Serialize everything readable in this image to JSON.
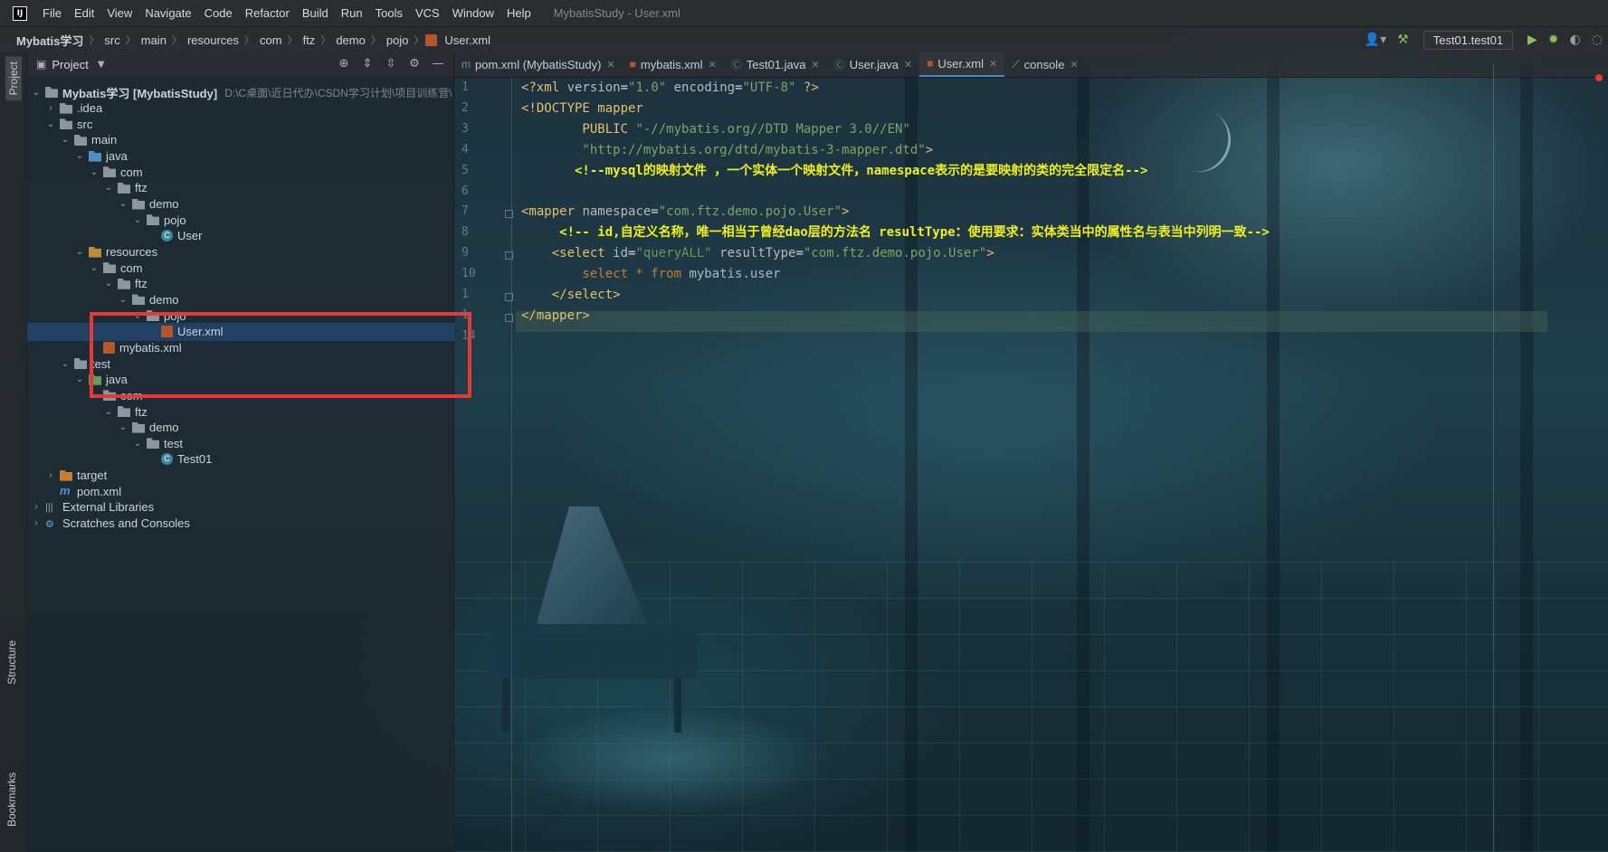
{
  "menubar": {
    "logo": "IJ",
    "items": [
      "File",
      "Edit",
      "View",
      "Navigate",
      "Code",
      "Refactor",
      "Build",
      "Run",
      "Tools",
      "VCS",
      "Window",
      "Help"
    ],
    "window_title": "MybatisStudy - User.xml"
  },
  "breadcrumb": [
    "Mybatis学习",
    "src",
    "main",
    "resources",
    "com",
    "ftz",
    "demo",
    "pojo",
    "User.xml"
  ],
  "toolbar": {
    "run_config": "Test01.test01"
  },
  "tool_strip": {
    "project": "Project",
    "structure": "Structure",
    "bookmarks": "Bookmarks"
  },
  "project_panel": {
    "title": "Project"
  },
  "tree": [
    {
      "label": "Mybatis学习 [MybatisStudy]",
      "hint": "D:\\C桌面\\近日代办\\CSDN学习计划\\项目训练营\\",
      "depth": 0,
      "chev": "v",
      "icon": "folder"
    },
    {
      "label": ".idea",
      "depth": 1,
      "chev": ">",
      "icon": "folder"
    },
    {
      "label": "src",
      "depth": 1,
      "chev": "v",
      "icon": "folder"
    },
    {
      "label": "main",
      "depth": 2,
      "chev": "v",
      "icon": "folder"
    },
    {
      "label": "java",
      "depth": 3,
      "chev": "v",
      "icon": "folder-blue"
    },
    {
      "label": "com",
      "depth": 4,
      "chev": "v",
      "icon": "pkg"
    },
    {
      "label": "ftz",
      "depth": 5,
      "chev": "v",
      "icon": "pkg"
    },
    {
      "label": "demo",
      "depth": 6,
      "chev": "v",
      "icon": "pkg"
    },
    {
      "label": "pojo",
      "depth": 7,
      "chev": "v",
      "icon": "pkg"
    },
    {
      "label": "User",
      "depth": 8,
      "chev": "",
      "icon": "class"
    },
    {
      "label": "resources",
      "depth": 3,
      "chev": "v",
      "icon": "folder-res"
    },
    {
      "label": "com",
      "depth": 4,
      "chev": "v",
      "icon": "pkg"
    },
    {
      "label": "ftz",
      "depth": 5,
      "chev": "v",
      "icon": "pkg"
    },
    {
      "label": "demo",
      "depth": 6,
      "chev": "v",
      "icon": "pkg"
    },
    {
      "label": "pojo",
      "depth": 7,
      "chev": "v",
      "icon": "pkg"
    },
    {
      "label": "User.xml",
      "depth": 8,
      "chev": "",
      "icon": "xml",
      "selected": true
    },
    {
      "label": "mybatis.xml",
      "depth": 4,
      "chev": "",
      "icon": "xml"
    },
    {
      "label": "test",
      "depth": 2,
      "chev": "v",
      "icon": "folder"
    },
    {
      "label": "java",
      "depth": 3,
      "chev": "v",
      "icon": "folder-green"
    },
    {
      "label": "com",
      "depth": 4,
      "chev": "v",
      "icon": "pkg"
    },
    {
      "label": "ftz",
      "depth": 5,
      "chev": "v",
      "icon": "pkg"
    },
    {
      "label": "demo",
      "depth": 6,
      "chev": "v",
      "icon": "pkg"
    },
    {
      "label": "test",
      "depth": 7,
      "chev": "v",
      "icon": "pkg"
    },
    {
      "label": "Test01",
      "depth": 8,
      "chev": "",
      "icon": "class"
    },
    {
      "label": "target",
      "depth": 1,
      "chev": ">",
      "icon": "folder-orange"
    },
    {
      "label": "pom.xml",
      "depth": 1,
      "chev": "",
      "icon": "maven"
    },
    {
      "label": "External Libraries",
      "depth": 0,
      "chev": ">",
      "icon": "lib"
    },
    {
      "label": "Scratches and Consoles",
      "depth": 0,
      "chev": ">",
      "icon": "scratch"
    }
  ],
  "tabs": [
    {
      "label": "pom.xml (MybatisStudy)",
      "icon": "m",
      "active": false
    },
    {
      "label": "mybatis.xml",
      "icon": "xml",
      "active": false
    },
    {
      "label": "Test01.java",
      "icon": "class",
      "active": false
    },
    {
      "label": "User.java",
      "icon": "class",
      "active": false
    },
    {
      "label": "User.xml",
      "icon": "xml",
      "active": true
    },
    {
      "label": "console",
      "icon": "console",
      "active": false
    }
  ],
  "line_numbers": [
    "1",
    "2",
    "3",
    "4",
    "5",
    "6",
    "7",
    "8",
    "9",
    "10",
    "1",
    "1",
    "14"
  ],
  "code_lines": [
    [
      [
        "t-tag",
        "<?xml "
      ],
      [
        "t-attr",
        "version"
      ],
      [
        "t-text",
        "="
      ],
      [
        "t-str",
        "\"1.0\""
      ],
      [
        "t-attr",
        " encoding"
      ],
      [
        "t-text",
        "="
      ],
      [
        "t-str",
        "\"UTF-8\""
      ],
      [
        "t-tag",
        " ?>"
      ]
    ],
    [
      [
        "t-tag",
        "<!DOCTYPE mapper"
      ]
    ],
    [
      [
        "t-tag",
        "        PUBLIC "
      ],
      [
        "t-str",
        "\"-//mybatis.org//DTD Mapper 3.0//EN\""
      ]
    ],
    [
      [
        "t-str",
        "        \"http://mybatis.org/dtd/mybatis-3-mapper.dtd\""
      ],
      [
        "t-tag",
        ">"
      ]
    ],
    [
      [
        "t-comment",
        "       <!--mysql的映射文件 ，一个实体一个映射文件，namespace表示的是要映射的类的完全限定名-->"
      ]
    ],
    [],
    [
      [
        "t-tag",
        "<mapper "
      ],
      [
        "t-attr",
        "namespace"
      ],
      [
        "t-text",
        "="
      ],
      [
        "t-str",
        "\"com.ftz.demo.pojo.User\""
      ],
      [
        "t-tag",
        ">"
      ]
    ],
    [
      [
        "t-comment",
        "     <!-- id,自定义名称，唯一相当于曾经dao层的方法名 resultType：使用要求：实体类当中的属性名与表当中列明一致-->"
      ]
    ],
    [
      [
        "t-tag",
        "    <select "
      ],
      [
        "t-attr",
        "id"
      ],
      [
        "t-text",
        "="
      ],
      [
        "t-val",
        "\"queryALL\""
      ],
      [
        "t-attr",
        " resultType"
      ],
      [
        "t-text",
        "="
      ],
      [
        "t-str",
        "\"com.ftz.demo.pojo.User\""
      ],
      [
        "t-tag",
        ">"
      ]
    ],
    [
      [
        "t-kw",
        "        select * from "
      ],
      [
        "t-plain",
        "mybatis.user"
      ]
    ],
    [
      [
        "t-tag",
        "    </select>"
      ]
    ],
    [
      [
        "t-tag",
        "</mapper>"
      ]
    ],
    []
  ]
}
